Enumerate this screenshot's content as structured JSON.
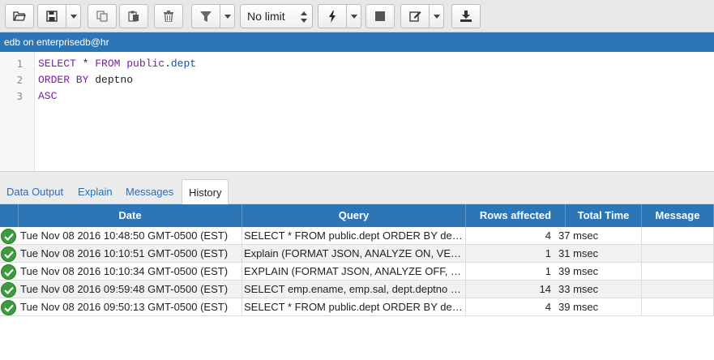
{
  "toolbar": {
    "icons": {
      "open": "folder-open-icon",
      "save": "save-icon",
      "copy": "copy-icon",
      "paste": "paste-icon",
      "delete": "trash-icon",
      "filter": "filter-icon",
      "execute": "lightning-icon",
      "stop": "stop-icon",
      "edit": "edit-icon",
      "download": "download-icon"
    },
    "limit_selected": "No limit"
  },
  "connection": {
    "label": "edb on enterprisedb@hr"
  },
  "editor": {
    "line_numbers": [
      "1",
      "2",
      "3"
    ],
    "lines": [
      [
        {
          "text": "SELECT",
          "kind": "keyword"
        },
        {
          "text": " * ",
          "kind": "plain"
        },
        {
          "text": "FROM",
          "kind": "keyword"
        },
        {
          "text": " ",
          "kind": "plain"
        },
        {
          "text": "public",
          "kind": "keyword"
        },
        {
          "text": ".",
          "kind": "plain"
        },
        {
          "text": "dept",
          "kind": "identifier"
        }
      ],
      [
        {
          "text": "ORDER BY",
          "kind": "keyword"
        },
        {
          "text": " deptno",
          "kind": "plain"
        }
      ],
      [
        {
          "text": "ASC",
          "kind": "keyword"
        }
      ]
    ],
    "colors": {
      "keyword": "#7a1ea1",
      "identifier": "#1a4f9c",
      "plain": "#222222"
    }
  },
  "tabs": [
    {
      "label": "Data Output",
      "active": false
    },
    {
      "label": "Explain",
      "active": false
    },
    {
      "label": "Messages",
      "active": false
    },
    {
      "label": "History",
      "active": true
    }
  ],
  "history": {
    "columns": [
      "Date",
      "Query",
      "Rows affected",
      "Total Time",
      "Message"
    ],
    "status_icon": "check-circle-icon",
    "rows": [
      {
        "date": "Tue Nov 08 2016 10:48:50 GMT-0500 (EST)",
        "query": "SELECT * FROM public.dept ORDER BY deptno ASC",
        "rows_affected": "4",
        "total_time": "37 msec",
        "message": ""
      },
      {
        "date": "Tue Nov 08 2016 10:10:51 GMT-0500 (EST)",
        "query": "Explain (FORMAT JSON, ANALYZE ON, VERBOSE OFF)",
        "rows_affected": "1",
        "total_time": "31 msec",
        "message": ""
      },
      {
        "date": "Tue Nov 08 2016 10:10:34 GMT-0500 (EST)",
        "query": "EXPLAIN (FORMAT JSON, ANALYZE OFF, VERBOSE OFF)",
        "rows_affected": "1",
        "total_time": "39 msec",
        "message": ""
      },
      {
        "date": "Tue Nov 08 2016 09:59:48 GMT-0500 (EST)",
        "query": "SELECT emp.ename, emp.sal, dept.deptno FROM emp",
        "rows_affected": "14",
        "total_time": "33 msec",
        "message": ""
      },
      {
        "date": "Tue Nov 08 2016 09:50:13 GMT-0500 (EST)",
        "query": "SELECT * FROM public.dept ORDER BY deptno ASC",
        "rows_affected": "4",
        "total_time": "39 msec",
        "message": ""
      }
    ]
  },
  "colors": {
    "accent": "#2c76b6",
    "success": "#3d9a3d"
  }
}
